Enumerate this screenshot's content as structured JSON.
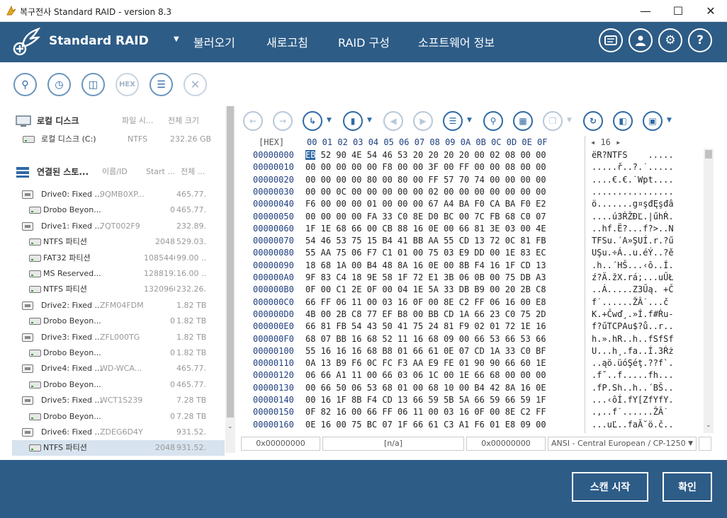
{
  "window": {
    "title": "복구전사 Standard RAID - version 8.3"
  },
  "header": {
    "brand": "Standard RAID",
    "menu": [
      "불러오기",
      "새로고침",
      "RAID 구성",
      "소프트웨어 정보"
    ]
  },
  "left": {
    "local_header": "로컬 디스크",
    "local_cols": [
      "파일 시...",
      "전체 크기"
    ],
    "local_item": {
      "name": "로컬 디스크 (C:)",
      "fs": "NTFS",
      "size": "232.26 GB"
    },
    "conn_header": "연결된 스토...",
    "conn_cols": [
      "이름/ID",
      "Start ...",
      "전체 ..."
    ],
    "tree": [
      {
        "name": "Drive0: Fixed ...",
        "id": "9QMB0XP...",
        "start": "",
        "size": "465.77...",
        "type": "drive"
      },
      {
        "name": "Drobo Beyon...",
        "id": "",
        "start": "0",
        "size": "465.77...",
        "type": "drobo"
      },
      {
        "name": "Drive1: Fixed ...",
        "id": "7QT002F9",
        "start": "",
        "size": "232.89...",
        "type": "drive"
      },
      {
        "name": "NTFS 파티션",
        "id": "",
        "start": "2048",
        "size": "529.03...",
        "type": "part"
      },
      {
        "name": "FAT32 파티션",
        "id": "",
        "start": "1085440",
        "size": "99.00 ...",
        "type": "part"
      },
      {
        "name": "MS Reserved...",
        "id": "",
        "start": "1288192",
        "size": "16.00 ...",
        "type": "part"
      },
      {
        "name": "NTFS 파티션",
        "id": "",
        "start": "1320960",
        "size": "232.26...",
        "type": "part"
      },
      {
        "name": "Drive2: Fixed ...",
        "id": "ZFM04FDM",
        "start": "",
        "size": "1.82 TB",
        "type": "drive"
      },
      {
        "name": "Drobo Beyon...",
        "id": "",
        "start": "0",
        "size": "1.82 TB",
        "type": "drobo"
      },
      {
        "name": "Drive3: Fixed ...",
        "id": "ZFL000TG",
        "start": "",
        "size": "1.82 TB",
        "type": "drive"
      },
      {
        "name": "Drobo Beyon...",
        "id": "",
        "start": "0",
        "size": "1.82 TB",
        "type": "drobo"
      },
      {
        "name": "Drive4: Fixed ...",
        "id": "WD-WCA...",
        "start": "",
        "size": "465.77...",
        "type": "drive"
      },
      {
        "name": "Drobo Beyon...",
        "id": "",
        "start": "0",
        "size": "465.77...",
        "type": "drobo"
      },
      {
        "name": "Drive5: Fixed ...",
        "id": "WCT1S239",
        "start": "",
        "size": "7.28 TB",
        "type": "drive"
      },
      {
        "name": "Drobo Beyon...",
        "id": "",
        "start": "0",
        "size": "7.28 TB",
        "type": "drobo"
      },
      {
        "name": "Drive6: Fixed ...",
        "id": "ZDEG6D4Y",
        "start": "",
        "size": "931.52...",
        "type": "drive"
      },
      {
        "name": "NTFS 파티션",
        "id": "",
        "start": "2048",
        "size": "931.52...",
        "type": "part",
        "selected": true
      }
    ]
  },
  "hex": {
    "head_label": "[HEX]",
    "columns": "00 01 02 03 04 05 06 07 08 09 0A 0B 0C 0D 0E 0F",
    "page_nav": "◂ 16 ▸",
    "rows": [
      {
        "off": "00000000",
        "bytes": "EB 52 90 4E 54 46 53 20 20 20 20 00 02 08 00 00",
        "asc": "ëR?NTFS    ....."
      },
      {
        "off": "00000010",
        "bytes": "00 00 00 00 00 F8 00 00 3F 00 FF 00 00 08 00 00",
        "asc": ".....ř..?.˙....."
      },
      {
        "off": "00000020",
        "bytes": "00 00 00 00 80 00 80 00 FF 57 70 74 00 00 00 00",
        "asc": "....€.€.˙Wpt...."
      },
      {
        "off": "00000030",
        "bytes": "00 00 0C 00 00 00 00 00 02 00 00 00 00 00 00 00",
        "asc": "................"
      },
      {
        "off": "00000040",
        "bytes": "F6 00 00 00 01 00 00 00 67 A4 BA F0 CA BA F0 E2",
        "asc": "ö.......g¤şđĘşđâ"
      },
      {
        "off": "00000050",
        "bytes": "00 00 00 00 FA 33 C0 8E D0 BC 00 7C FB 68 C0 07",
        "asc": "....ú3ŔŽĐĽ.|űhŔ."
      },
      {
        "off": "00000060",
        "bytes": "1F 1E 68 66 00 CB 88 16 0E 00 66 81 3E 03 00 4E",
        "asc": "..hf.Ë?...f?>..N"
      },
      {
        "off": "00000070",
        "bytes": "54 46 53 75 15 B4 41 BB AA 55 CD 13 72 0C 81 FB",
        "asc": "TFSu.´A»ŞUÍ.r.?ű"
      },
      {
        "off": "00000080",
        "bytes": "55 AA 75 06 F7 C1 01 00 75 03 E9 DD 00 1E 83 EC",
        "asc": "UŞu.÷Á..u.éÝ..?ě"
      },
      {
        "off": "00000090",
        "bytes": "18 68 1A 00 B4 48 8A 16 0E 00 8B F4 16 1F CD 13",
        "asc": ".h..´HŠ...‹ô..Í."
      },
      {
        "off": "000000A0",
        "bytes": "9F 83 C4 18 9E 58 1F 72 E1 3B 06 0B 00 75 DB A3",
        "asc": "ź?Ä.žX.rá;...uŰŁ"
      },
      {
        "off": "000000B0",
        "bytes": "0F 00 C1 2E 0F 00 04 1E 5A 33 DB B9 00 20 2B C8",
        "asc": "..Á.....Z3Űą. +Č"
      },
      {
        "off": "000000C0",
        "bytes": "66 FF 06 11 00 03 16 0F 00 8E C2 FF 06 16 00 E8",
        "asc": "f˙......ŽÂ˙...č"
      },
      {
        "off": "000000D0",
        "bytes": "4B 00 2B C8 77 EF B8 00 BB CD 1A 66 23 C0 75 2D",
        "asc": "K.+Čwď¸.»Í.f#Ŕu-"
      },
      {
        "off": "000000E0",
        "bytes": "66 81 FB 54 43 50 41 75 24 81 F9 02 01 72 1E 16",
        "asc": "f?űTCPAu$?ů..r.."
      },
      {
        "off": "000000F0",
        "bytes": "68 07 BB 16 68 52 11 16 68 09 00 66 53 66 53 66",
        "asc": "h.».hR..h..fSfSf"
      },
      {
        "off": "00000100",
        "bytes": "55 16 16 16 68 B8 01 66 61 0E 07 CD 1A 33 C0 BF",
        "asc": "U...h¸.fa..Í.3Ŕż"
      },
      {
        "off": "00000110",
        "bytes": "0A 13 B9 F6 0C FC F3 AA E9 FE 01 90 90 66 60 1E",
        "asc": "..ąö.üóŞéţ.??f`."
      },
      {
        "off": "00000120",
        "bytes": "06 66 A1 11 00 66 03 06 1C 00 1E 66 68 00 00 00",
        "asc": ".f˘..f.....fh..."
      },
      {
        "off": "00000130",
        "bytes": "00 66 50 06 53 68 01 00 68 10 00 B4 42 8A 16 0E",
        "asc": ".fP.Sh..h..´BŠ.."
      },
      {
        "off": "00000140",
        "bytes": "00 16 1F 8B F4 CD 13 66 59 5B 5A 66 59 66 59 1F",
        "asc": "...‹ôÍ.fY[ZfYfY."
      },
      {
        "off": "00000150",
        "bytes": "0F 82 16 00 66 FF 06 11 00 03 16 0F 00 8E C2 FF",
        "asc": ".,..f˙......ŽÂ˙"
      },
      {
        "off": "00000160",
        "bytes": "0E 16 00 75 BC 07 1F 66 61 C3 A1 F6 01 E8 09 00",
        "asc": "...uĽ..faĂ˘ö.č.."
      }
    ]
  },
  "status": {
    "offset": "0x00000000",
    "value": "[n/a]",
    "offset2": "0x00000000",
    "encoding": "ANSI - Central European / CP-1250"
  },
  "footer": {
    "scan": "스캔 시작",
    "ok": "확인"
  }
}
